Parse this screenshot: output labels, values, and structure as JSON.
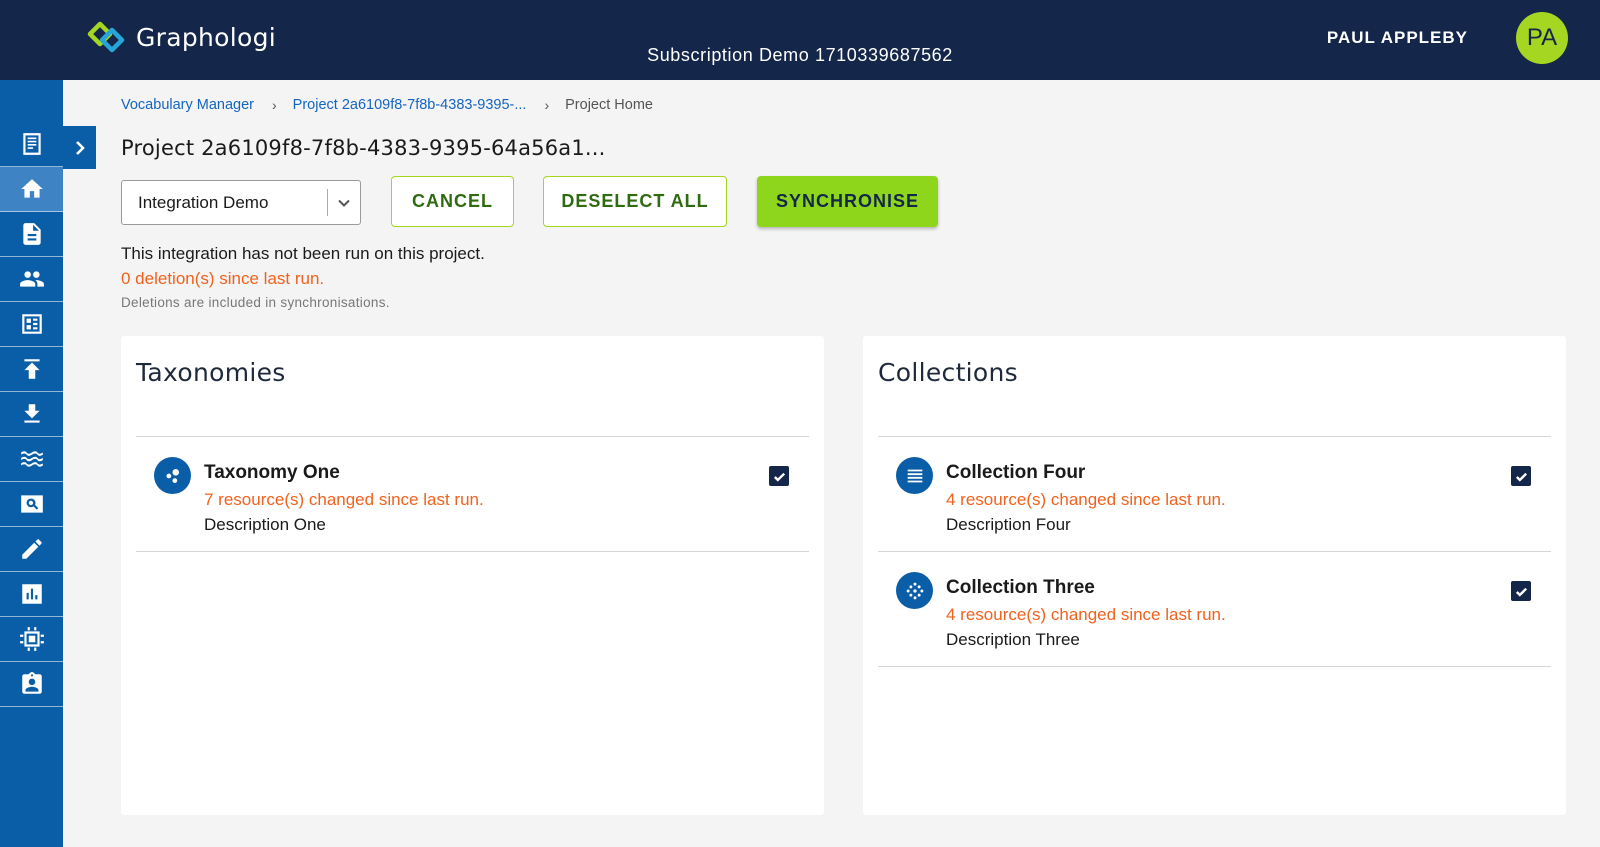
{
  "header": {
    "app_name": "Graphologi",
    "subscription": "Subscription Demo 1710339687562",
    "user_name": "PAUL APPLEBY",
    "user_initials": "PA"
  },
  "sidebar": {
    "items": [
      {
        "icon": "document-list-icon"
      },
      {
        "icon": "home-icon",
        "active": true
      },
      {
        "icon": "file-icon"
      },
      {
        "icon": "people-icon"
      },
      {
        "icon": "dashboard-icon"
      },
      {
        "icon": "upload-icon"
      },
      {
        "icon": "download-icon"
      },
      {
        "icon": "waves-icon"
      },
      {
        "icon": "search-screen-icon"
      },
      {
        "icon": "pencil-icon"
      },
      {
        "icon": "bar-chart-icon"
      },
      {
        "icon": "chip-icon"
      },
      {
        "icon": "badge-icon"
      }
    ]
  },
  "breadcrumb": {
    "items": [
      "Vocabulary Manager",
      "Project 2a6109f8-7f8b-4383-9395-..."
    ],
    "current": "Project Home"
  },
  "page": {
    "title": "Project 2a6109f8-7f8b-4383-9395-64a56a1..."
  },
  "controls": {
    "integration_select": "Integration Demo",
    "cancel_label": "CANCEL",
    "deselect_label": "DESELECT ALL",
    "sync_label": "SYNCHRONISE"
  },
  "status": {
    "run_status": "This integration has not been run on this project.",
    "deletions": "0 deletion(s) since last run.",
    "deletions_note": "Deletions are included in synchronisations."
  },
  "taxonomies": {
    "title": "Taxonomies",
    "items": [
      {
        "name": "Taxonomy One",
        "changed": "7 resource(s) changed since last run.",
        "description": "Description One",
        "checked": true
      }
    ]
  },
  "collections": {
    "title": "Collections",
    "items": [
      {
        "name": "Collection Four",
        "changed": "4 resource(s) changed since last run.",
        "description": "Description Four",
        "checked": true
      },
      {
        "name": "Collection Three",
        "changed": "4 resource(s) changed since last run.",
        "description": "Description Three",
        "checked": true
      }
    ]
  },
  "colors": {
    "header_bg": "#142649",
    "sidebar_bg": "#0a5ea8",
    "accent_green": "#8ed61b",
    "warning_orange": "#f0621e"
  }
}
